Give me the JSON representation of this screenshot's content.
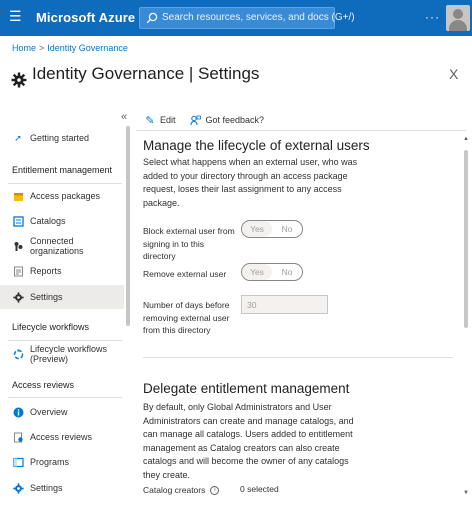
{
  "topbar": {
    "brand": "Microsoft Azure",
    "search_placeholder": "Search resources, services, and docs (G+/)",
    "more": "···"
  },
  "breadcrumb": {
    "home": "Home",
    "separator": ">",
    "current": "Identity Governance"
  },
  "page": {
    "title": "Identity Governance | Settings",
    "more": "···",
    "close": "X"
  },
  "sidebar": {
    "collapse": "«",
    "getting_started": "Getting started",
    "sections": [
      {
        "title": "Entitlement management",
        "items": [
          "Access packages",
          "Catalogs",
          "Connected organizations",
          "Reports",
          "Settings"
        ]
      },
      {
        "title": "Lifecycle workflows",
        "items": [
          "Lifecycle workflows (Preview)"
        ]
      },
      {
        "title": "Access reviews",
        "items": [
          "Overview",
          "Access reviews",
          "Programs",
          "Settings"
        ]
      }
    ],
    "active": "Settings"
  },
  "toolbar": {
    "edit": "Edit",
    "feedback": "Got feedback?"
  },
  "external_users": {
    "heading": "Manage the lifecycle of external users",
    "description": "Select what happens when an external user, who was added to your directory through an access package request, loses their last assignment to any access package.",
    "block_label": "Block external user from signing in to this directory",
    "remove_label": "Remove external user",
    "days_label": "Number of days before removing external user from this directory",
    "yes": "Yes",
    "no": "No",
    "days_value": "30"
  },
  "delegate": {
    "heading": "Delegate entitlement management",
    "description": "By default, only Global Administrators and User Administrators can create and manage catalogs, and can manage all catalogs. Users added to entitlement management as Catalog creators can also create catalogs and will become the owner of any catalogs they create.",
    "creators_label": "Catalog creators",
    "creators_value": "0 selected",
    "info": "i"
  },
  "colors": {
    "azure_blue": "#0f6cbd",
    "link": "#0078d4",
    "active_bg": "#edebe9"
  }
}
